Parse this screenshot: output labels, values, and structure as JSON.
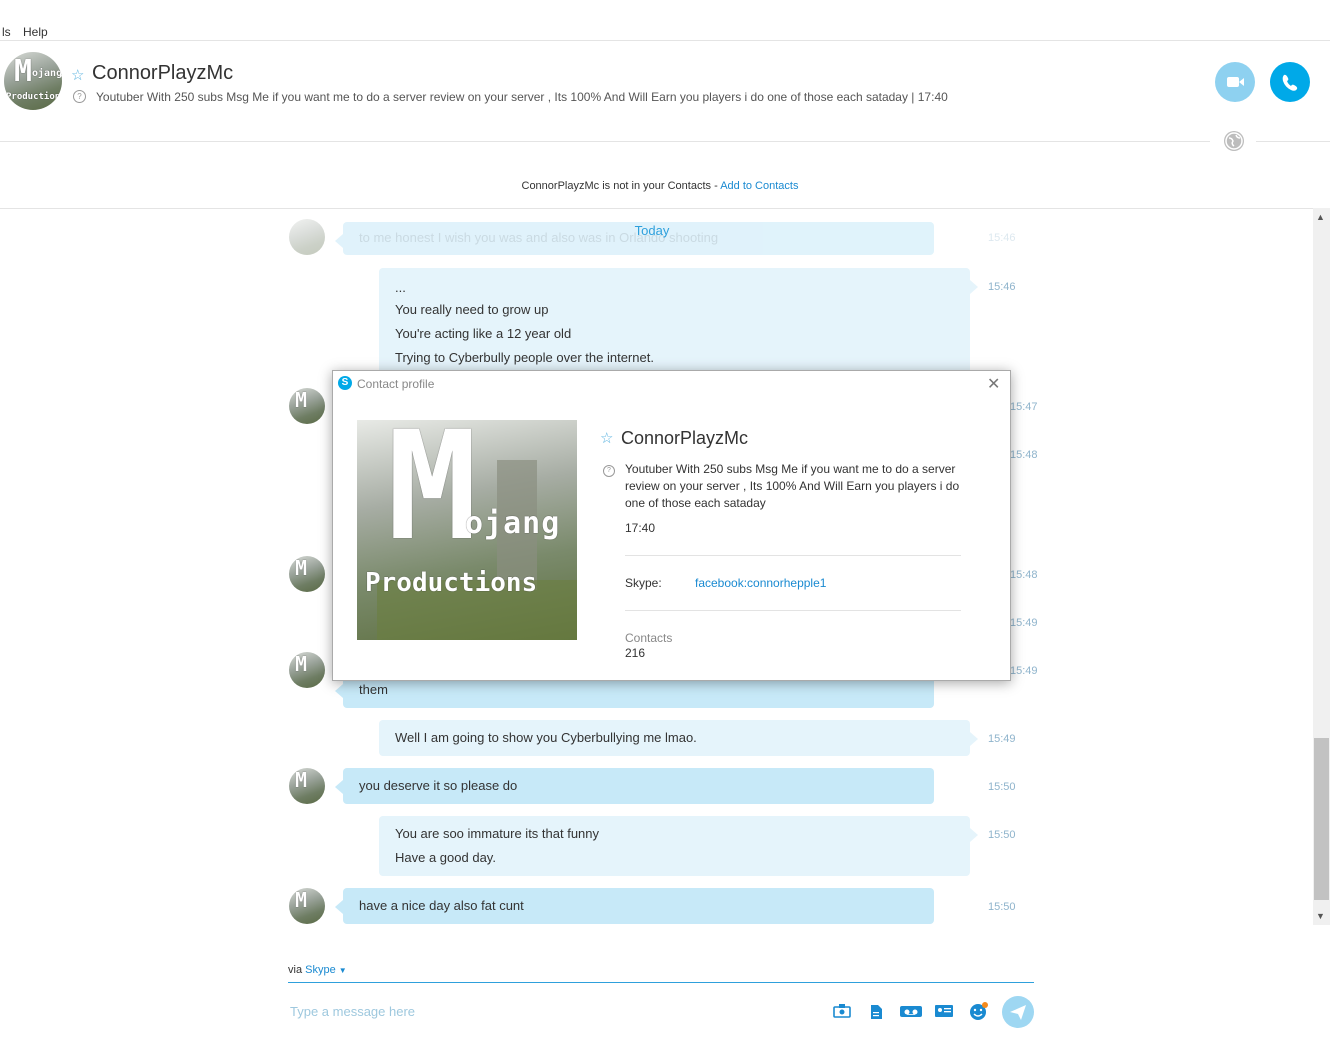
{
  "menu": {
    "items": [
      "ls",
      "Help"
    ]
  },
  "contact": {
    "name": "ConnorPlayzMc",
    "mood": "Youtuber With 250 subs Msg Me if you want me to do a server review on your server , Its 100% And Will Earn you players i do one of those each sataday  |  17:40",
    "avatar_text_1": "M",
    "avatar_text_2": "ojang",
    "avatar_text_3": "Productions"
  },
  "notice": {
    "text": "ConnorPlayzMc is not in your Contacts - ",
    "link": "Add to Contacts"
  },
  "chat": {
    "today": "Today",
    "messages": [
      {
        "dir": "in",
        "lines": [
          "to me honest I wish you was and also was in Orlando shooting"
        ],
        "time": "15:46"
      },
      {
        "dir": "out",
        "lines": [
          "...",
          "You really need to grow up",
          "You're acting like a 12 year old",
          "Trying to Cyberbully people over the internet."
        ],
        "time": "15:46"
      },
      {
        "dir": "in",
        "lines": [
          "them"
        ],
        "time": "15:49"
      },
      {
        "dir": "out",
        "lines": [
          "Well I am going to show you Cyberbullying me lmao."
        ],
        "time": "15:49"
      },
      {
        "dir": "in",
        "lines": [
          "you deserve it so please do"
        ],
        "time": "15:50"
      },
      {
        "dir": "out",
        "lines": [
          "You are soo immature its that funny",
          "Have a good day."
        ],
        "time": "15:50"
      },
      {
        "dir": "in",
        "lines": [
          "have a nice day also fat cunt"
        ],
        "time": "15:50"
      }
    ],
    "hidden_times": [
      "15:47",
      "15:48",
      "15:48",
      "15:49",
      "15:49"
    ]
  },
  "compose": {
    "via": "via",
    "via_service": "Skype",
    "placeholder": "Type a message here"
  },
  "dialog": {
    "title": "Contact profile",
    "close": "✕",
    "name": "ConnorPlayzMc",
    "mood": "Youtuber With 250 subs Msg Me if you want me to do a server review on your server , Its 100% And Will Earn you players i do one of those each sataday",
    "time": "17:40",
    "skype_label": "Skype:",
    "skype_value": "facebook:connorhepple1",
    "contacts_label": "Contacts",
    "contacts_value": "216"
  },
  "colors": {
    "accent": "#00a9e8",
    "bubble_in": "#c7e9f8",
    "bubble_out": "#e5f4fb"
  },
  "icons": [
    "star-icon",
    "mood-help-icon",
    "video-call-icon",
    "audio-call-icon",
    "globe-icon",
    "send-icon",
    "media-icon",
    "file-icon",
    "video-message-icon",
    "contact-card-icon",
    "emoticon-icon"
  ]
}
